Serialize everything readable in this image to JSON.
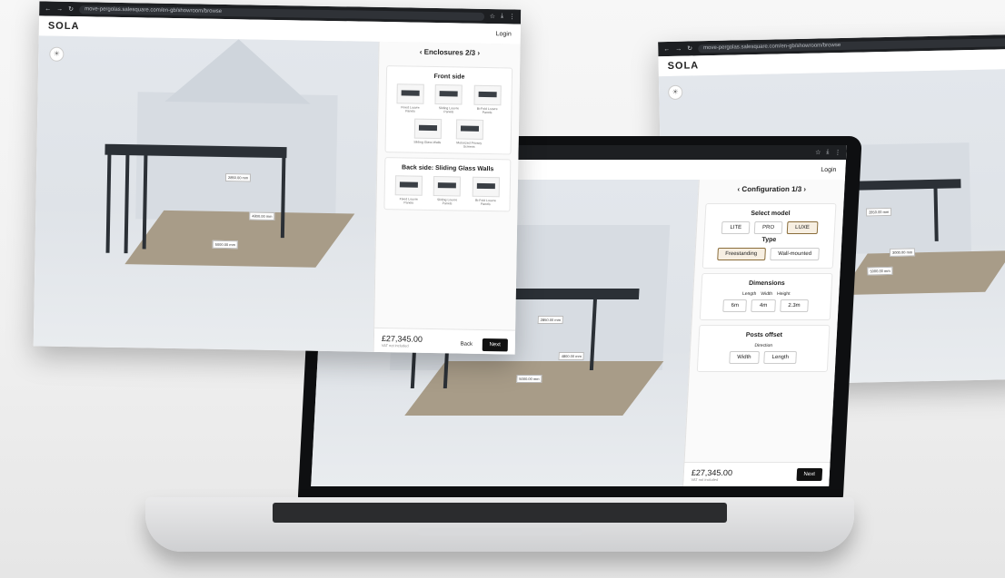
{
  "back_window": {
    "url": "move-pergolas.salesquare.com/en-gb/showroom/browse",
    "logo": "SOLA",
    "tags": [
      "2850.00 mm",
      "3000.00 mm",
      "5000.00 mm"
    ]
  },
  "left_window": {
    "url": "move-pergolas.salesquare.com/en-gb/showroom/browse",
    "logo": "SOLA",
    "login": "Login",
    "panel_title": "Enclosures 2/3",
    "front_title": "Front side",
    "front_options": [
      "Fixed Louvre Panels",
      "Sliding Louvre Panels",
      "Bi-Fold Louvre Panels",
      "Sliding Glass Walls",
      "Motorized Privacy Screens"
    ],
    "back_title": "Back side: Sliding Glass Walls",
    "back_options": [
      "Fixed Louvre Panels",
      "Sliding Louvre Panels",
      "Bi-Fold Louvre Panels"
    ],
    "price": "£27,345.00",
    "price_note": "VAT not included",
    "back_label": "Back",
    "next_label": "Next",
    "tags": [
      "2850.00 mm",
      "4800.00 mm",
      "5000.00 mm"
    ]
  },
  "laptop": {
    "login": "Login",
    "panel_title": "Configuration 1/3",
    "model_title": "Select model",
    "models": [
      "LITE",
      "PRO",
      "LUXE"
    ],
    "type_label": "Type",
    "types": [
      "Freestanding",
      "Wall-mounted"
    ],
    "dimensions_title": "Dimensions",
    "length_label": "Length",
    "width_label": "Width",
    "height_label": "Height",
    "length_value": "6m",
    "width_value": "4m",
    "height_value": "2.3m",
    "posts_title": "Posts offset",
    "direction_label": "Direction",
    "directions": [
      "Width",
      "Length"
    ],
    "price": "£27,345.00",
    "price_note": "VAT not included",
    "next_label": "Next",
    "tags": [
      "2850.00 mm",
      "4800.00 mm",
      "5000.00 mm"
    ]
  }
}
